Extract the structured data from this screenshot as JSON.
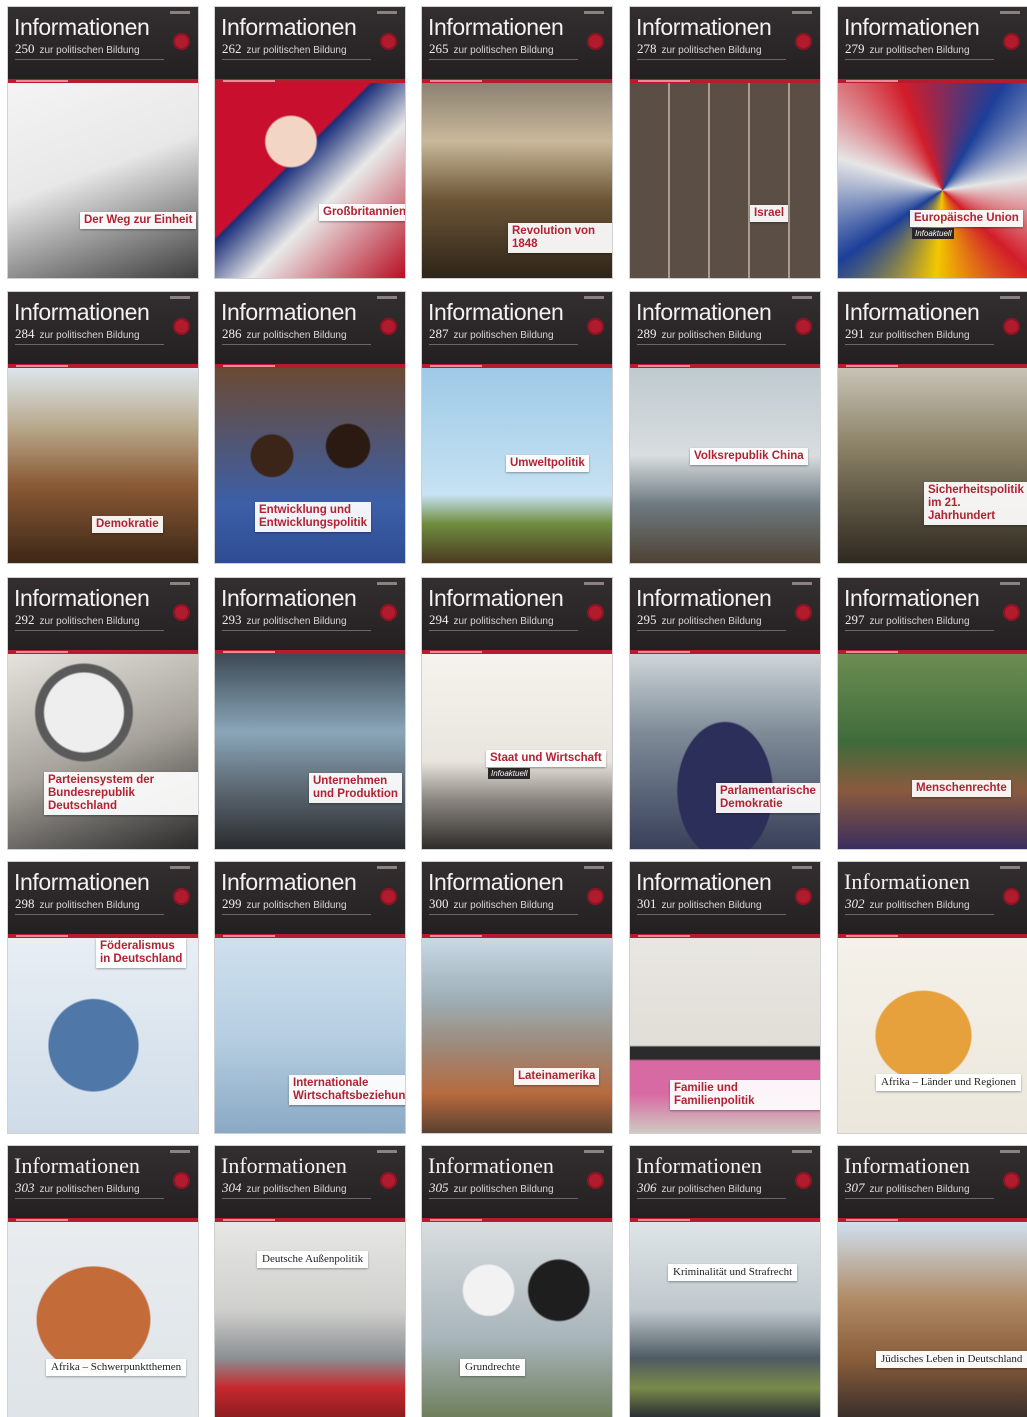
{
  "series_name": "Informationen",
  "series_subtitle": "zur politischen Bildung",
  "badge_text": "Infoaktuell",
  "colors": {
    "header": "#231f20",
    "accent": "#b71c2e",
    "label_text": "#b22233"
  },
  "covers": [
    {
      "issue": "250",
      "topic": "Der Weg zur Einheit",
      "style": "sans"
    },
    {
      "issue": "262",
      "topic": "Großbritannien",
      "style": "sans"
    },
    {
      "issue": "265",
      "topic": "Revolution von 1848",
      "style": "sans"
    },
    {
      "issue": "278",
      "topic": "Israel",
      "style": "sans"
    },
    {
      "issue": "279",
      "topic": "Europäische Union",
      "style": "sans",
      "badge": true
    },
    {
      "issue": "284",
      "topic": "Demokratie",
      "style": "sans"
    },
    {
      "issue": "286",
      "topic": "Entwicklung und\nEntwicklungspolitik",
      "style": "sans"
    },
    {
      "issue": "287",
      "topic": "Umweltpolitik",
      "style": "sans"
    },
    {
      "issue": "289",
      "topic": "Volksrepublik China",
      "style": "sans"
    },
    {
      "issue": "291",
      "topic": "Sicherheitspolitik\nim 21. Jahrhundert",
      "style": "sans"
    },
    {
      "issue": "292",
      "topic": "Parteiensystem der\nBundesrepublik Deutschland",
      "style": "sans"
    },
    {
      "issue": "293",
      "topic": "Unternehmen\nund Produktion",
      "style": "sans"
    },
    {
      "issue": "294",
      "topic": "Staat und Wirtschaft",
      "style": "sans",
      "badge": true
    },
    {
      "issue": "295",
      "topic": "Parlamentarische\nDemokratie",
      "style": "sans"
    },
    {
      "issue": "297",
      "topic": "Menschenrechte",
      "style": "sans"
    },
    {
      "issue": "298",
      "topic": "Föderalismus\nin Deutschland",
      "style": "sans"
    },
    {
      "issue": "299",
      "topic": "Internationale\nWirtschaftsbeziehungen",
      "style": "sans"
    },
    {
      "issue": "300",
      "topic": "Lateinamerika",
      "style": "sans"
    },
    {
      "issue": "301",
      "topic": "Familie und Familienpolitik",
      "style": "sans"
    },
    {
      "issue": "302",
      "topic": "Afrika – Länder und Regionen",
      "style": "serif"
    },
    {
      "issue": "303",
      "topic": "Afrika – Schwerpunktthemen",
      "style": "serif"
    },
    {
      "issue": "304",
      "topic": "Deutsche Außenpolitik",
      "style": "serif"
    },
    {
      "issue": "305",
      "topic": "Grundrechte",
      "style": "serif"
    },
    {
      "issue": "306",
      "topic": "Kriminalität und Strafrecht",
      "style": "serif"
    },
    {
      "issue": "307",
      "topic": "Jüdisches Leben in Deutschland",
      "style": "serif"
    }
  ]
}
